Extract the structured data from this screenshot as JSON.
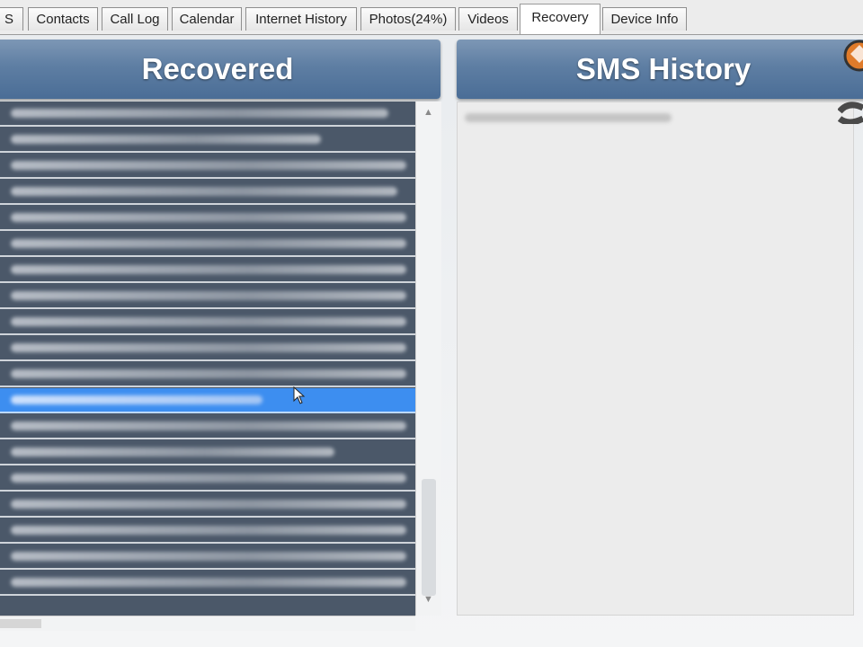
{
  "tabs": [
    {
      "label": "S",
      "active": false
    },
    {
      "label": "Contacts",
      "active": false
    },
    {
      "label": "Call Log",
      "active": false
    },
    {
      "label": "Calendar",
      "active": false
    },
    {
      "label": "Internet History",
      "active": false
    },
    {
      "label": "Photos(24%)",
      "active": false
    },
    {
      "label": "Videos",
      "active": false
    },
    {
      "label": "Recovery",
      "active": true
    },
    {
      "label": "Device Info",
      "active": false
    }
  ],
  "left_panel": {
    "title": "Recovered",
    "row_count": 19,
    "selected_row_index": 11
  },
  "right_panel": {
    "title": "SMS History"
  },
  "colors": {
    "header_gradient_top": "#7d97b5",
    "header_gradient_bottom": "#4a6d96",
    "list_background": "#4b5869",
    "selection": "#3d8ef0"
  },
  "icons": [
    "logo-icon",
    "mouse-cursor-icon",
    "scroll-up-arrow-icon",
    "scroll-down-arrow-icon"
  ]
}
